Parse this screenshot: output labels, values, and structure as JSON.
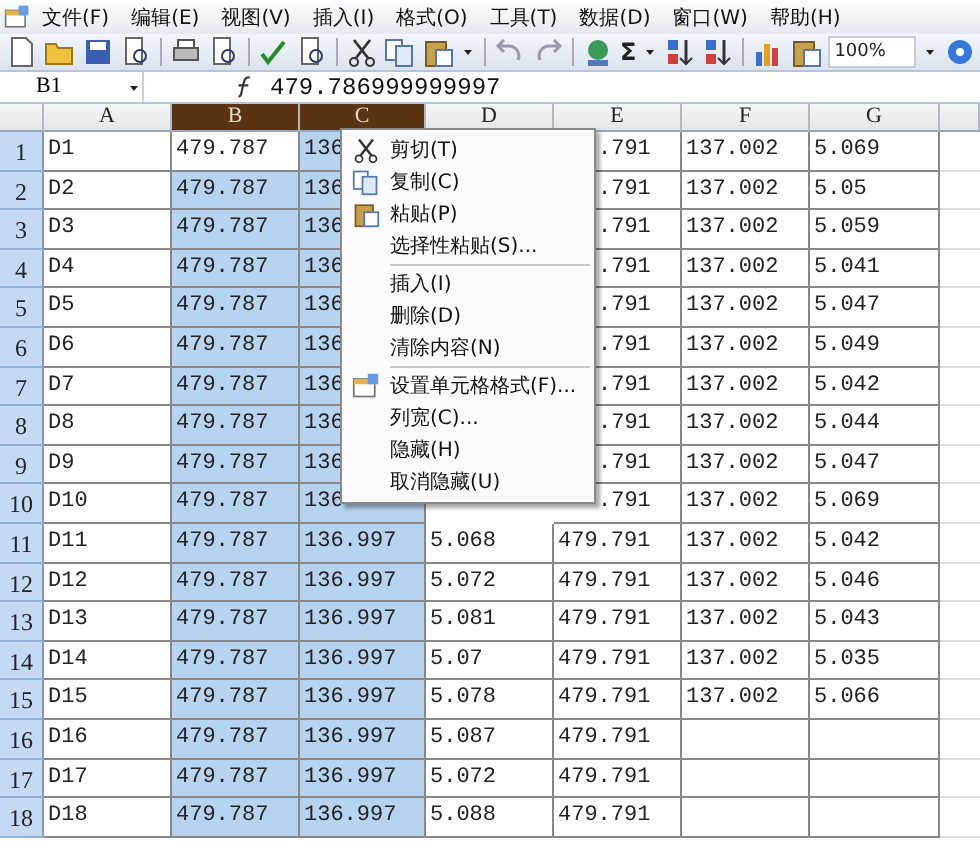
{
  "menu_bar": [
    "文件(F)",
    "编辑(E)",
    "视图(V)",
    "插入(I)",
    "格式(O)",
    "工具(T)",
    "数据(D)",
    "窗口(W)",
    "帮助(H)"
  ],
  "toolbar": {
    "sum_symbol": "Σ",
    "zoom": "100%"
  },
  "formula_bar": {
    "name_box": "B1",
    "formula": "479.786999999997"
  },
  "columns": [
    {
      "label": "A",
      "selected": false
    },
    {
      "label": "B",
      "selected": true
    },
    {
      "label": "C",
      "selected": true
    },
    {
      "label": "D",
      "selected": false
    },
    {
      "label": "E",
      "selected": false
    },
    {
      "label": "F",
      "selected": false
    },
    {
      "label": "G",
      "selected": false
    }
  ],
  "rows": [
    {
      "number": "1",
      "active": true,
      "under_menu": true,
      "cells": [
        "D1",
        "479.787",
        "136",
        null,
        ".791",
        "137.002",
        "5.069"
      ]
    },
    {
      "number": "2",
      "under_menu": true,
      "cells": [
        "D2",
        "479.787",
        "136",
        null,
        ".791",
        "137.002",
        "5.05"
      ]
    },
    {
      "number": "3",
      "under_menu": true,
      "cells": [
        "D3",
        "479.787",
        "136",
        null,
        ".791",
        "137.002",
        "5.059"
      ]
    },
    {
      "number": "4",
      "under_menu": true,
      "cells": [
        "D4",
        "479.787",
        "136",
        null,
        ".791",
        "137.002",
        "5.041"
      ]
    },
    {
      "number": "5",
      "under_menu": true,
      "cells": [
        "D5",
        "479.787",
        "136",
        null,
        ".791",
        "137.002",
        "5.047"
      ]
    },
    {
      "number": "6",
      "under_menu": true,
      "cells": [
        "D6",
        "479.787",
        "136",
        null,
        ".791",
        "137.002",
        "5.049"
      ]
    },
    {
      "number": "7",
      "under_menu": true,
      "cells": [
        "D7",
        "479.787",
        "136",
        null,
        ".791",
        "137.002",
        "5.042"
      ]
    },
    {
      "number": "8",
      "under_menu": true,
      "cells": [
        "D8",
        "479.787",
        "136",
        null,
        ".791",
        "137.002",
        "5.044"
      ]
    },
    {
      "number": "9",
      "under_menu": true,
      "cells": [
        "D9",
        "479.787",
        "136",
        null,
        ".791",
        "137.002",
        "5.047"
      ]
    },
    {
      "number": "10",
      "under_menu": true,
      "cells": [
        "D10",
        "479.787",
        "136",
        null,
        ".791",
        "137.002",
        "5.069"
      ]
    },
    {
      "number": "11",
      "under_menu": false,
      "cells": [
        "D11",
        "479.787",
        "136.997",
        "5.068",
        "479.791",
        "137.002",
        "5.042"
      ]
    },
    {
      "number": "12",
      "under_menu": false,
      "cells": [
        "D12",
        "479.787",
        "136.997",
        "5.072",
        "479.791",
        "137.002",
        "5.046"
      ]
    },
    {
      "number": "13",
      "under_menu": false,
      "cells": [
        "D13",
        "479.787",
        "136.997",
        "5.081",
        "479.791",
        "137.002",
        "5.043"
      ]
    },
    {
      "number": "14",
      "under_menu": false,
      "cells": [
        "D14",
        "479.787",
        "136.997",
        "5.07",
        "479.791",
        "137.002",
        "5.035"
      ]
    },
    {
      "number": "15",
      "under_menu": false,
      "cells": [
        "D15",
        "479.787",
        "136.997",
        "5.078",
        "479.791",
        "137.002",
        "5.066"
      ]
    },
    {
      "number": "16",
      "under_menu": false,
      "cells": [
        "D16",
        "479.787",
        "136.997",
        "5.087",
        "479.791",
        null,
        null
      ]
    },
    {
      "number": "17",
      "under_menu": false,
      "cells": [
        "D17",
        "479.787",
        "136.997",
        "5.072",
        "479.791",
        null,
        null
      ]
    },
    {
      "number": "18",
      "under_menu": false,
      "cells": [
        "D18",
        "479.787",
        "136.997",
        "5.088",
        "479.791",
        null,
        null
      ]
    }
  ],
  "context_menu": [
    {
      "label": "剪切(T)",
      "kind": "cut",
      "separator_before": false
    },
    {
      "label": "复制(C)",
      "kind": "copy",
      "separator_before": false
    },
    {
      "label": "粘贴(P)",
      "kind": "paste",
      "separator_before": false
    },
    {
      "label": "选择性粘贴(S)...",
      "kind": "plain",
      "separator_before": false
    },
    {
      "label": "插入(I)",
      "kind": "plain",
      "separator_before": true
    },
    {
      "label": "删除(D)",
      "kind": "plain",
      "separator_before": false
    },
    {
      "label": "清除内容(N)",
      "kind": "plain",
      "separator_before": false
    },
    {
      "label": "设置单元格格式(F)...",
      "kind": "format",
      "separator_before": true
    },
    {
      "label": "列宽(C)...",
      "kind": "plain",
      "separator_before": false
    },
    {
      "label": "隐藏(H)",
      "kind": "plain",
      "separator_before": false
    },
    {
      "label": "取消隐藏(U)",
      "kind": "plain",
      "separator_before": false
    }
  ]
}
